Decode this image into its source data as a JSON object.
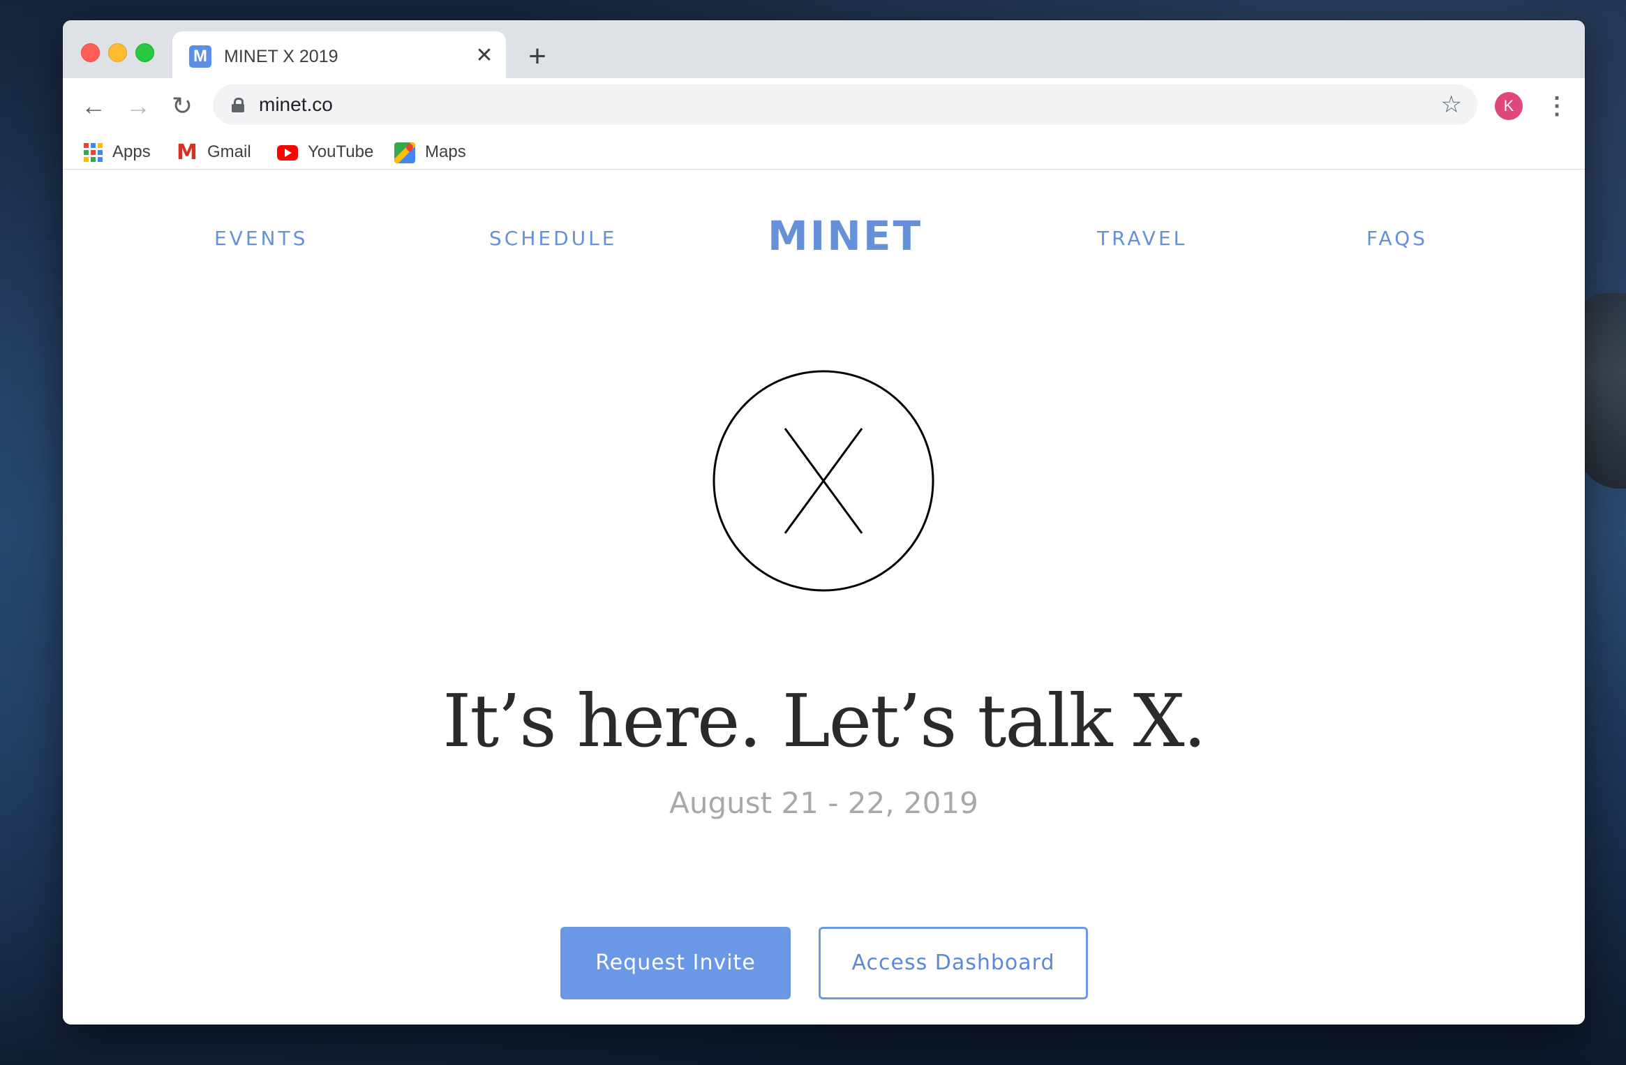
{
  "browser": {
    "tab": {
      "favicon_letter": "M",
      "title": "MINET X 2019",
      "close_glyph": "✕"
    },
    "new_tab_glyph": "+",
    "nav": {
      "back_glyph": "←",
      "forward_glyph": "→",
      "reload_glyph": "↻"
    },
    "omnibox": {
      "url": "minet.co",
      "bookmark_star_glyph": "☆"
    },
    "profile_initial": "K",
    "menu_glyph": "⋮",
    "bookmarks": [
      {
        "label": "Apps",
        "icon": "apps-grid-icon"
      },
      {
        "label": "Gmail",
        "icon": "gmail-icon"
      },
      {
        "label": "YouTube",
        "icon": "youtube-icon"
      },
      {
        "label": "Maps",
        "icon": "maps-icon"
      }
    ]
  },
  "site": {
    "nav": {
      "events": "EVENTS",
      "schedule": "SCHEDULE",
      "logo": "MINET",
      "travel": "TRAVEL",
      "faqs": "FAQS"
    },
    "hero": {
      "headline": "It’s here. Let’s talk X.",
      "dates": "August 21 - 22, 2019",
      "primary_cta": "Request Invite",
      "secondary_cta": "Access Dashboard"
    }
  },
  "colors": {
    "accent": "#6b98e6",
    "profile": "#e0457b",
    "headline": "#2a2a2a",
    "dates": "#a8a8a8"
  }
}
